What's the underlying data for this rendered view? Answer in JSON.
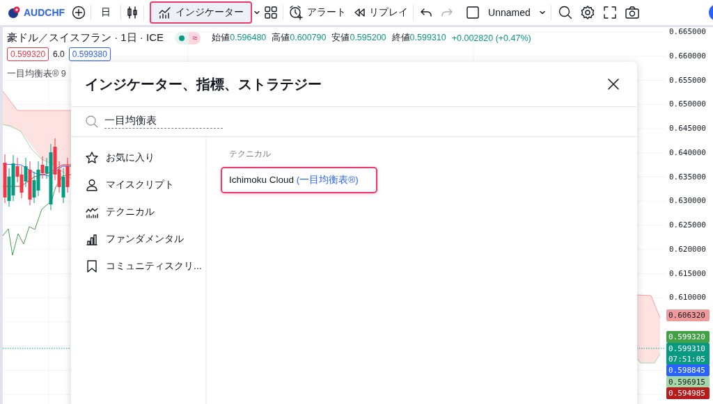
{
  "toolbar": {
    "symbol": "AUDCHF",
    "interval": "日",
    "indicators_button": {
      "label": "インジケーター",
      "highlighted": true
    },
    "alert": "アラート",
    "replay": "リプレイ",
    "redo_disabled": true,
    "layout_name": "Unnamed"
  },
  "legend": {
    "title": "豪ドル／スイスフラン · 1日 · ICE",
    "status_badge": "≈",
    "quotes": [
      {
        "label": "始値",
        "value": "0.596480"
      },
      {
        "label": "高値",
        "value": "0.600790"
      },
      {
        "label": "安値",
        "value": "0.595200"
      },
      {
        "label": "終値",
        "value": "0.599310"
      }
    ],
    "change": "+0.002820 (+0.47%)",
    "bid": "0.599320",
    "spread": "6.0",
    "ask": "0.599380",
    "indicator": "一目均衡表® 9"
  },
  "price_axis": {
    "ticks": [
      "0.665000",
      "0.660000",
      "0.655000",
      "0.650000",
      "0.645000",
      "0.640000",
      "0.635000",
      "0.630000",
      "0.625000",
      "0.620000",
      "0.615000",
      "0.610000"
    ],
    "labels": [
      {
        "value": "0.606320",
        "color": "#ef9a9a"
      },
      {
        "value": "0.599320",
        "color": "#43a047"
      },
      {
        "value": "0.599310",
        "time": "07:51:05",
        "color": "#089981"
      },
      {
        "value": "0.598845",
        "color": "#2962ff"
      },
      {
        "value": "0.596915",
        "color": "#a5d6a7"
      },
      {
        "value": "0.594985",
        "color": "#b71c1c"
      }
    ]
  },
  "dialog": {
    "title": "インジケーター、指標、ストラテジー",
    "search": {
      "value": "一目均衡表"
    },
    "categories": [
      {
        "kind": "star",
        "label": "お気に入り",
        "selected": false
      },
      {
        "kind": "person",
        "label": "マイスクリプト",
        "selected": false
      },
      {
        "kind": "technical",
        "label": "テクニカル",
        "selected": false
      },
      {
        "kind": "bars",
        "label": "ファンダメンタル",
        "selected": false
      },
      {
        "kind": "bookmark",
        "label": "コミュニティスクリ...",
        "selected": false
      }
    ],
    "section": "テクニカル",
    "results": [
      {
        "name": "Ichimoku Cloud",
        "alias": "(一目均衡表®)",
        "highlighted": true
      }
    ]
  }
}
